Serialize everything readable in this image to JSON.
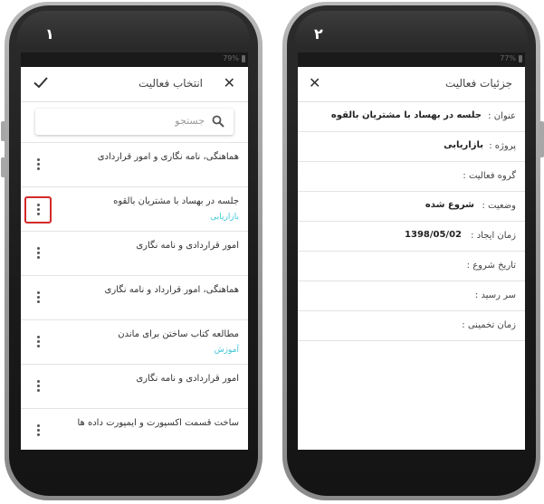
{
  "phone_left": {
    "number": "١",
    "status_text": "79%",
    "title": "انتخاب فعالیت",
    "search_placeholder": "جستجو",
    "items": [
      {
        "label": "هماهنگی، نامه نگاری و امور قراردادی",
        "sub": ""
      },
      {
        "label": "جلسه در بهساد با مشتریان بالقوه",
        "sub": "بازاریابی"
      },
      {
        "label": "امور قراردادی و نامه نگاری",
        "sub": ""
      },
      {
        "label": "هماهنگی، امور قرارداد و نامه نگاری",
        "sub": ""
      },
      {
        "label": "مطالعه کتاب ساختن برای ماندن",
        "sub": "آموزش"
      },
      {
        "label": "امور قراردادی و نامه نگاری",
        "sub": ""
      },
      {
        "label": "ساخت قسمت اکسپورت و ایمپورت داده ها",
        "sub": ""
      }
    ]
  },
  "phone_right": {
    "number": "٢",
    "status_text": "77%",
    "title": "جزئیات فعالیت",
    "rows": [
      {
        "key": "عنوان :",
        "value": "جلسه در بهساد با مشتریان بالقوه"
      },
      {
        "key": "پروژه :",
        "value": "بازاریابی"
      },
      {
        "key": "گروه فعالیت :",
        "value": ""
      },
      {
        "key": "وضعیت :",
        "value": "شروع شده"
      },
      {
        "key": "زمان ایجاد :",
        "value": "1398/05/02"
      },
      {
        "key": "تاریخ شروع :",
        "value": ""
      },
      {
        "key": "سر رسید :",
        "value": ""
      },
      {
        "key": "زمان تخمینی :",
        "value": ""
      }
    ]
  },
  "colors": {
    "accent": "#3ec6d6",
    "highlight": "#d32a2a"
  },
  "icons": [
    "check-icon",
    "close-icon",
    "search-icon",
    "more-vert-icon"
  ]
}
